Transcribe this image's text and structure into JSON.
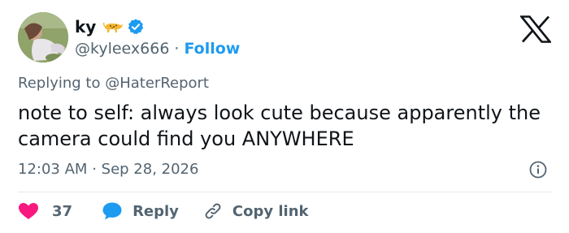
{
  "author": {
    "display_name": "ky",
    "handle": "@kyleex666",
    "separator": "·",
    "follow_label": "Follow",
    "emoji_icon": "leopard-icon",
    "verified_icon": "verified-badge-icon"
  },
  "platform_icon": "x-logo-icon",
  "reply_context": {
    "prefix": "Replying to",
    "mention": "@HaterReport"
  },
  "tweet": {
    "text": "note to self: always look cute because apparently the camera could find you ANYWHERE",
    "time": "12:03 AM",
    "separator": "·",
    "date": "Sep 28, 2026"
  },
  "actions": {
    "like_count": "37",
    "reply_label": "Reply",
    "copy_label": "Copy link"
  },
  "colors": {
    "accent": "#1d9bf0",
    "like": "#f91880",
    "secondary_text": "#536471",
    "primary_text": "#0f1419"
  }
}
